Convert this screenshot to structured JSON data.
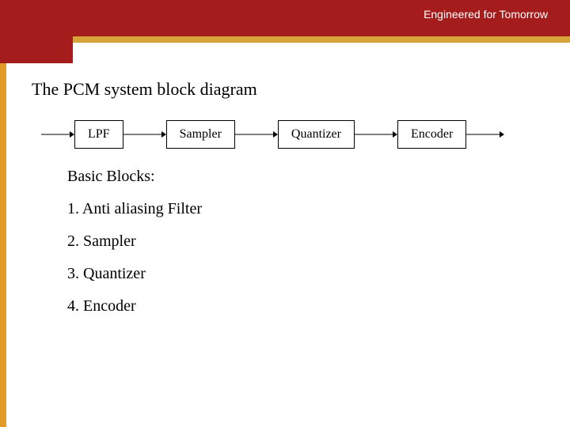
{
  "header": {
    "tagline": "Engineered for Tomorrow"
  },
  "colors": {
    "red": "#a51c1c",
    "gold": "#d7a43a",
    "accent": "#e29a29"
  },
  "slide": {
    "title": "The PCM system block diagram"
  },
  "diagram": {
    "blocks": [
      "LPF",
      "Sampler",
      "Quantizer",
      "Encoder"
    ]
  },
  "body": {
    "heading": "Basic Blocks:",
    "items": [
      "1. Anti aliasing Filter",
      "2. Sampler",
      "3. Quantizer",
      "4. Encoder"
    ]
  }
}
